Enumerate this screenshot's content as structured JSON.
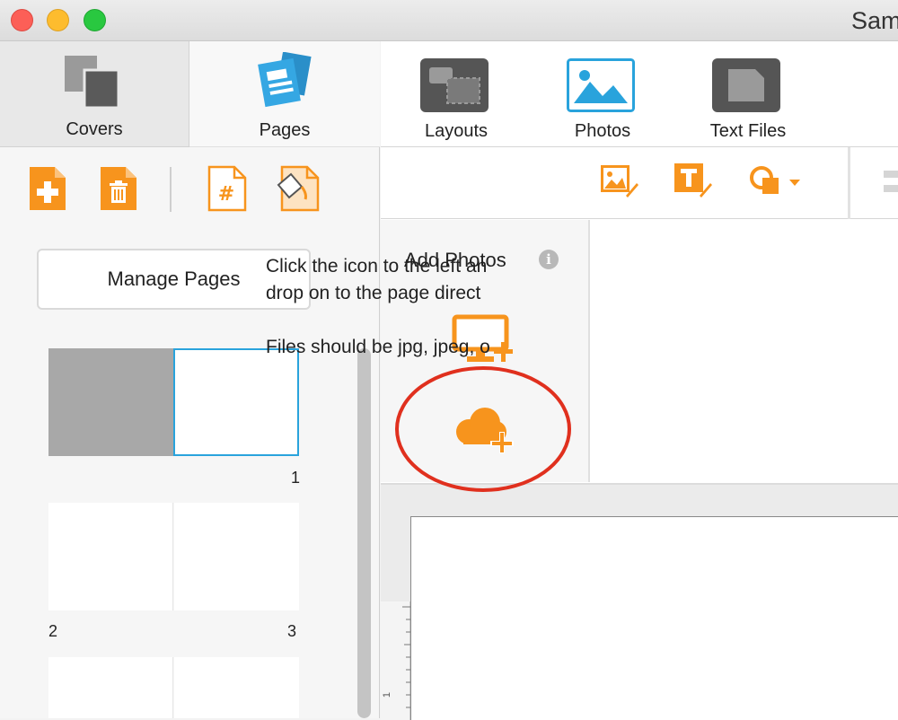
{
  "window": {
    "title": "Sam"
  },
  "left_tabs": {
    "covers": "Covers",
    "pages": "Pages"
  },
  "page_tools": [
    "add-page-icon",
    "delete-page-icon",
    "page-numbers-icon",
    "page-background-icon"
  ],
  "manage_pages_label": "Manage Pages",
  "page_thumbnails": {
    "numbers": [
      "1",
      "2",
      "3"
    ]
  },
  "top_nav": {
    "layouts": "Layouts",
    "photos": "Photos",
    "text_files": "Text Files"
  },
  "edit_tools": [
    "image-edit-icon",
    "text-edit-icon",
    "shape-dropdown-icon"
  ],
  "add_photos": {
    "title": "Add Photos",
    "info": "i",
    "sources": [
      "computer-upload-icon",
      "cloud-upload-icon"
    ]
  },
  "instructions": {
    "line1": "Click the icon to the left an",
    "line2": "drop on to the page direct",
    "line3": "Files should be jpg, jpeg, o"
  },
  "ruler_mark": "1",
  "colors": {
    "accent_orange": "#f7941d",
    "selection_blue": "#29a3dc",
    "highlight_red": "#e0301e",
    "dark_icon": "#555555"
  }
}
